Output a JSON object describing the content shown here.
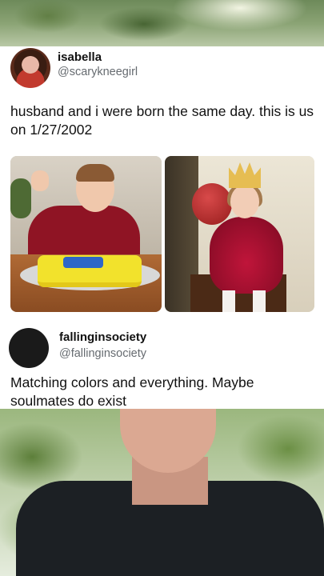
{
  "post": {
    "author": {
      "display_name": "isabella",
      "handle": "@scarykneegirl",
      "avatar_icon": "profile-photo"
    },
    "text": "husband and i were born the same day. this is us on 1/27/2002",
    "photos": [
      {
        "description_icon": "photo-boy-birthday-cake"
      },
      {
        "description_icon": "photo-girl-crown-balloon"
      }
    ]
  },
  "reply": {
    "author": {
      "display_name": "fallinginsociety",
      "handle": "@fallinginsociety",
      "avatar_icon": "profile-photo"
    },
    "text": "Matching colors and everything. Maybe soulmates do exist"
  },
  "colors": {
    "handle_gray": "#666b70",
    "text": "#111111",
    "background": "#ffffff"
  }
}
